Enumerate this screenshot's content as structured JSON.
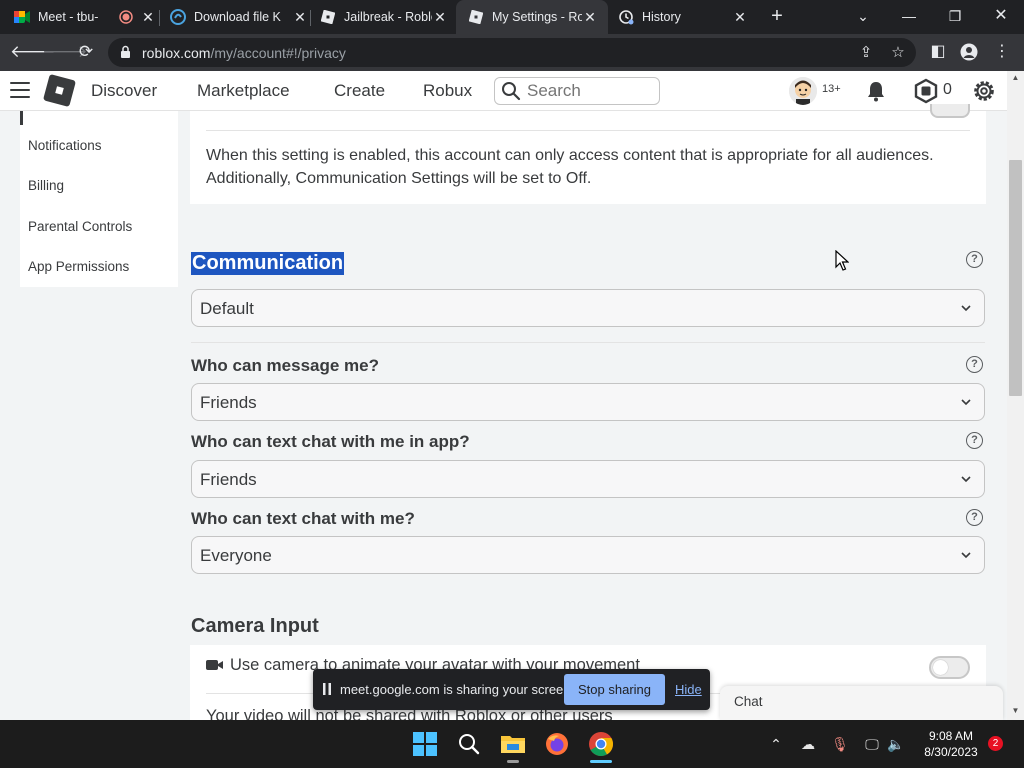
{
  "browser": {
    "tabs": [
      {
        "title": "Meet - tbu-",
        "icon": "google-meet-icon"
      },
      {
        "title": "Download file K",
        "icon": "download-site-icon"
      },
      {
        "title": "Jailbreak - Roblo",
        "icon": "roblox-icon"
      },
      {
        "title": "My Settings - Ro",
        "icon": "roblox-icon",
        "active": true
      },
      {
        "title": "History",
        "icon": "history-icon"
      }
    ],
    "url_domain": "roblox.com",
    "url_path": "/my/account#!/privacy"
  },
  "header": {
    "nav": [
      "Discover",
      "Marketplace",
      "Create",
      "Robux"
    ],
    "search_placeholder": "Search",
    "age_badge": "13+",
    "robux_balance": "0"
  },
  "sidebar": {
    "items": [
      "Notifications",
      "Billing",
      "Parental Controls",
      "App Permissions"
    ]
  },
  "content": {
    "account_restriction_desc": "When this setting is enabled, this account can only access content that is appropriate for all audiences. Additionally, Communication Settings will be set to Off.",
    "communication": {
      "title": "Communication",
      "preset_value": "Default",
      "questions": [
        {
          "label": "Who can message me?",
          "value": "Friends"
        },
        {
          "label": "Who can text chat with me in app?",
          "value": "Friends"
        },
        {
          "label": "Who can text chat with me?",
          "value": "Everyone"
        }
      ]
    },
    "camera": {
      "title": "Camera Input",
      "option_label": "Use camera to animate your avatar with your movement",
      "option_enabled": false,
      "note": "Your video will not be shared with Roblox or other users"
    }
  },
  "share_banner": {
    "message": "meet.google.com is sharing your screen.",
    "stop_label": "Stop sharing",
    "hide_label": "Hide"
  },
  "chat": {
    "label": "Chat"
  },
  "taskbar": {
    "time": "9:08 AM",
    "date": "8/30/2023",
    "notification_count": "2"
  }
}
